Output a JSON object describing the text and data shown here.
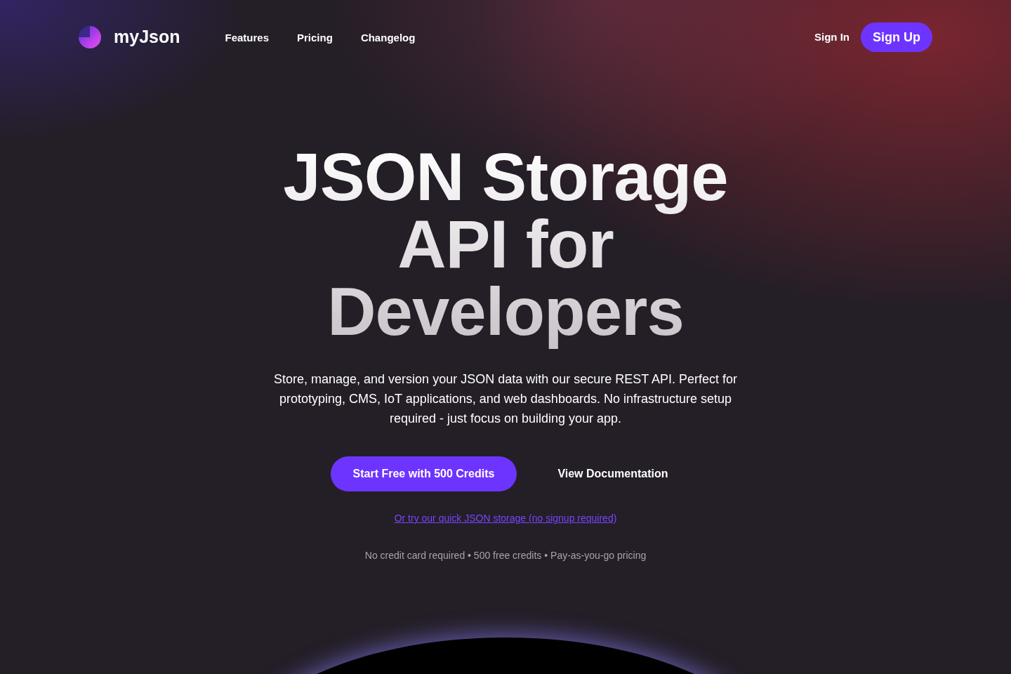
{
  "header": {
    "brand": "myJson",
    "nav": [
      {
        "label": "Features"
      },
      {
        "label": "Pricing"
      },
      {
        "label": "Changelog"
      }
    ],
    "sign_in": "Sign In",
    "sign_up": "Sign Up"
  },
  "hero": {
    "title": "JSON Storage API for Developers",
    "subtitle": "Store, manage, and version your JSON data with our secure REST API. Perfect for prototyping, CMS, IoT applications, and web dashboards. No infrastructure setup required - just focus on building your app.",
    "primary_button": "Start Free with 500 Credits",
    "secondary_button": "View Documentation",
    "quick_link": "Or try our quick JSON storage (no signup required)",
    "note": "No credit card required • 500 free credits • Pay-as-you-go pricing"
  }
}
